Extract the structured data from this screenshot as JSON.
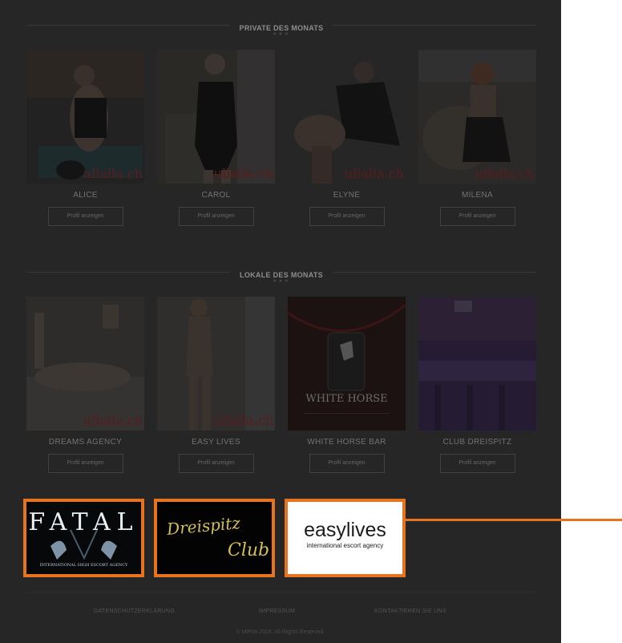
{
  "sections": {
    "private": {
      "title": "PRIVATE DES MONATS",
      "cards": [
        {
          "name": "ALICE",
          "button": "Profil anzeigen",
          "watermark": "ullalla.ch"
        },
        {
          "name": "CAROL",
          "button": "Profil anzeigen",
          "watermark": "ullalla.ch"
        },
        {
          "name": "ELYNE",
          "button": "Profil anzeigen",
          "watermark": "ullalla.ch"
        },
        {
          "name": "MILENA",
          "button": "Profil anzeigen",
          "watermark": "ullalla.ch"
        }
      ]
    },
    "local": {
      "title": "LOKALE DES MONATS",
      "cards": [
        {
          "name": "DREAMS AGENCY",
          "button": "Profil anzeigen",
          "watermark": "ullalla.ch"
        },
        {
          "name": "EASY LIVES",
          "button": "Profil anzeigen",
          "watermark": "ullalla.ch"
        },
        {
          "name": "WHITE HORSE BAR",
          "button": "Profil anzeigen",
          "watermark": "",
          "logo_text": "WHITE HORSE"
        },
        {
          "name": "CLUB DREISPITZ",
          "button": "Profil anzeigen",
          "watermark": ""
        }
      ]
    }
  },
  "ads": {
    "fatal": {
      "logo": "FATAL",
      "tagline": "INTERNATIONAL HIGH ESCORT AGENCY"
    },
    "dreispitz": {
      "line1": "Dreispitz",
      "line2": "Club"
    },
    "easylives": {
      "logo": "easylives",
      "tagline": "international escort agency"
    }
  },
  "footer": {
    "links": [
      "DATENSCHUTZERKLÄRUNG",
      "IMPRESSUM",
      "KONTAKTIEREN SIE UNS"
    ],
    "copyright": "© MiPoti 2018. All Rights Reserved."
  },
  "colors": {
    "accent": "#e8731f",
    "overlay": "#262626"
  }
}
